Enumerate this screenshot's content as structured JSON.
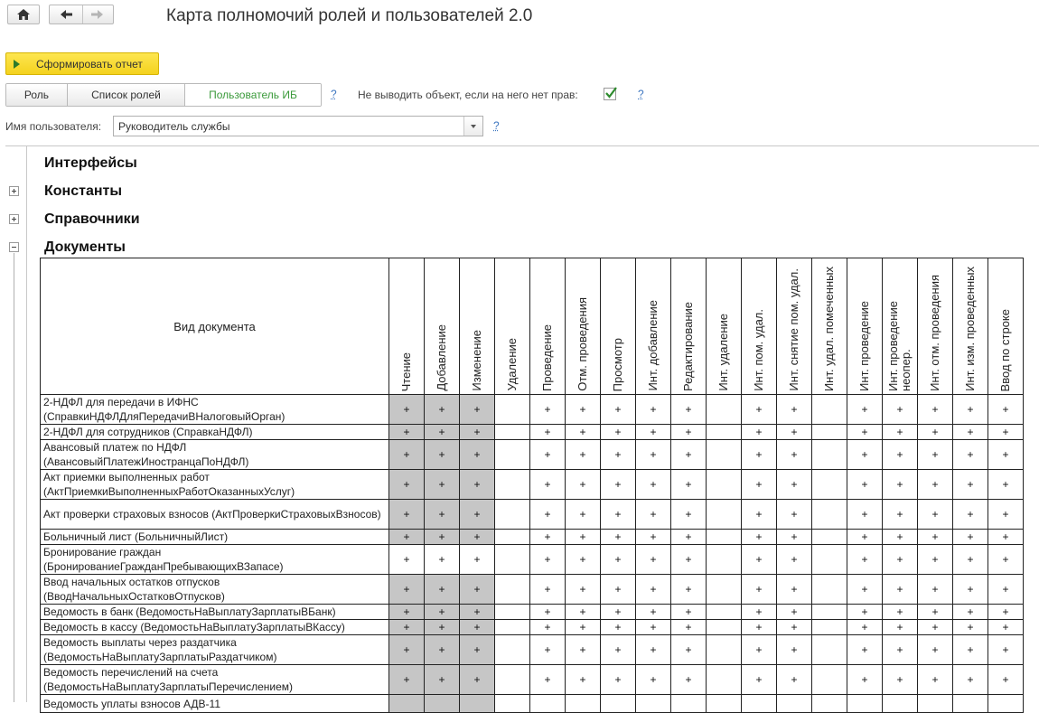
{
  "nav": {
    "home_icon": "home-icon",
    "back_icon": "back-arrow-icon",
    "forward_icon": "forward-arrow-icon"
  },
  "title": "Карта полномочий ролей и пользователей 2.0",
  "run_button": "Сформировать отчет",
  "tabs": [
    "Роль",
    "Список ролей",
    "Пользователь ИБ"
  ],
  "help_mark": "?",
  "hide_objects_label": "Не выводить объект, если на него нет прав:",
  "hide_objects_checked": true,
  "user_label": "Имя пользователя:",
  "user_value": "Руководитель службы",
  "groups": [
    {
      "label": "Интерфейсы",
      "expander": "none"
    },
    {
      "label": "Константы",
      "expander": "plus"
    },
    {
      "label": "Справочники",
      "expander": "plus"
    },
    {
      "label": "Документы",
      "expander": "minus"
    }
  ],
  "table": {
    "first_header": "Вид документа",
    "columns": [
      "Чтение",
      "Добавление",
      "Изменение",
      "Удаление",
      "Проведение",
      "Отм. проведения",
      "Просмотр",
      "Инт. добавление",
      "Редактирование",
      "Инт. удаление",
      "Инт. пом. удал.",
      "Инт. снятие пом. удал.",
      "Инт. удал. помеченных",
      "Инт. проведение",
      "Инт. проведение неопер.",
      "Инт. отм. проведения",
      "Инт. изм. проведенных",
      "Ввод по строке"
    ],
    "rows": [
      {
        "name": "2-НДФЛ для передачи в ИФНС (СправкиНДФЛДляПередачиВНалоговыйОрган)",
        "gray": true,
        "marks": [
          "+",
          "+",
          "+",
          "",
          "+",
          "+",
          "+",
          "+",
          "+",
          "",
          "+",
          "+",
          "",
          "+",
          "+",
          "+",
          "+",
          "+"
        ]
      },
      {
        "name": "2-НДФЛ для сотрудников (СправкаНДФЛ)",
        "gray": true,
        "marks": [
          "+",
          "+",
          "+",
          "",
          "+",
          "+",
          "+",
          "+",
          "+",
          "",
          "+",
          "+",
          "",
          "+",
          "+",
          "+",
          "+",
          "+"
        ]
      },
      {
        "name": "Авансовый платеж по НДФЛ (АвансовыйПлатежИностранцаПоНДФЛ)",
        "gray": true,
        "marks": [
          "+",
          "+",
          "+",
          "",
          "+",
          "+",
          "+",
          "+",
          "+",
          "",
          "+",
          "+",
          "",
          "+",
          "+",
          "+",
          "+",
          "+"
        ]
      },
      {
        "name": "Акт приемки выполненных работ (АктПриемкиВыполненныхРаботОказанныхУслуг)",
        "gray": true,
        "marks": [
          "+",
          "+",
          "+",
          "",
          "+",
          "+",
          "+",
          "+",
          "+",
          "",
          "+",
          "+",
          "",
          "+",
          "+",
          "+",
          "+",
          "+"
        ]
      },
      {
        "name": "Акт проверки страховых взносов (АктПроверкиСтраховыхВзносов)",
        "gray": true,
        "marks": [
          "+",
          "+",
          "+",
          "",
          "+",
          "+",
          "+",
          "+",
          "+",
          "",
          "+",
          "+",
          "",
          "+",
          "+",
          "+",
          "+",
          "+"
        ]
      },
      {
        "name": "Больничный лист (БольничныйЛист)",
        "gray": true,
        "marks": [
          "+",
          "+",
          "+",
          "",
          "+",
          "+",
          "+",
          "+",
          "+",
          "",
          "+",
          "+",
          "",
          "+",
          "+",
          "+",
          "+",
          "+"
        ]
      },
      {
        "name": "Бронирование граждан (БронированиеГражданПребывающихВЗапасе)",
        "gray": false,
        "marks": [
          "+",
          "+",
          "+",
          "",
          "+",
          "+",
          "+",
          "+",
          "+",
          "",
          "+",
          "+",
          "",
          "+",
          "+",
          "+",
          "+",
          "+"
        ]
      },
      {
        "name": "Ввод начальных остатков отпусков (ВводНачальныхОстатковОтпусков)",
        "gray": true,
        "marks": [
          "+",
          "+",
          "+",
          "",
          "+",
          "+",
          "+",
          "+",
          "+",
          "",
          "+",
          "+",
          "",
          "+",
          "+",
          "+",
          "+",
          "+"
        ]
      },
      {
        "name": "Ведомость в банк (ВедомостьНаВыплатуЗарплатыВБанк)",
        "gray": true,
        "marks": [
          "+",
          "+",
          "+",
          "",
          "+",
          "+",
          "+",
          "+",
          "+",
          "",
          "+",
          "+",
          "",
          "+",
          "+",
          "+",
          "+",
          "+"
        ]
      },
      {
        "name": "Ведомость в кассу (ВедомостьНаВыплатуЗарплатыВКассу)",
        "gray": true,
        "marks": [
          "+",
          "+",
          "+",
          "",
          "+",
          "+",
          "+",
          "+",
          "+",
          "",
          "+",
          "+",
          "",
          "+",
          "+",
          "+",
          "+",
          "+"
        ]
      },
      {
        "name": "Ведомость выплаты через раздатчика (ВедомостьНаВыплатуЗарплатыРаздатчиком)",
        "gray": true,
        "marks": [
          "+",
          "+",
          "+",
          "",
          "+",
          "+",
          "+",
          "+",
          "+",
          "",
          "+",
          "+",
          "",
          "+",
          "+",
          "+",
          "+",
          "+"
        ]
      },
      {
        "name": "Ведомость перечислений на счета (ВедомостьНаВыплатуЗарплатыПеречислением)",
        "gray": true,
        "marks": [
          "+",
          "+",
          "+",
          "",
          "+",
          "+",
          "+",
          "+",
          "+",
          "",
          "+",
          "+",
          "",
          "+",
          "+",
          "+",
          "+",
          "+"
        ]
      },
      {
        "name": "Ведомость уплаты взносов АДВ-11",
        "gray": true,
        "marks": [
          "",
          "",
          "",
          "",
          "",
          "",
          "",
          "",
          "",
          "",
          "",
          "",
          "",
          "",
          "",
          "",
          "",
          ""
        ]
      }
    ]
  }
}
